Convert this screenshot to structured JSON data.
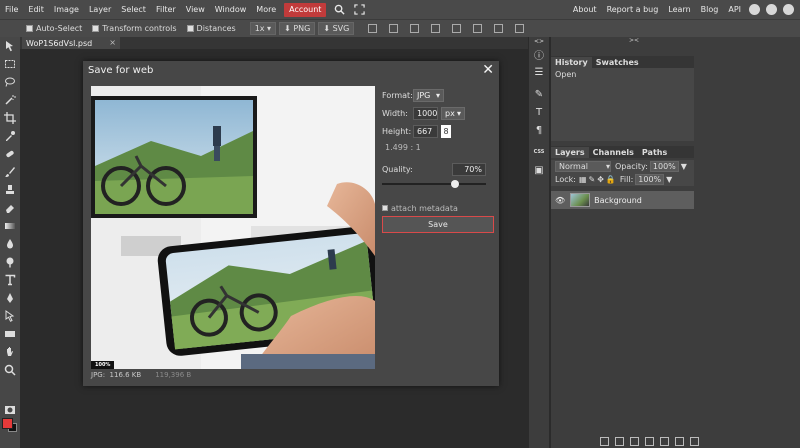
{
  "menubar": {
    "items": [
      "File",
      "Edit",
      "Image",
      "Layer",
      "Select",
      "Filter",
      "View",
      "Window",
      "More"
    ],
    "account": "Account",
    "right_links": [
      "About",
      "Report a bug",
      "Learn",
      "Blog",
      "API"
    ]
  },
  "options_bar": {
    "auto_select": "Auto-Select",
    "transform_controls": "Transform controls",
    "distances": "Distances",
    "zoom": "1x",
    "export_png": "PNG",
    "export_svg": "SVG"
  },
  "document_tab": {
    "name": "WoP1S6dVsl.psd",
    "close": "×"
  },
  "dialog": {
    "title": "Save for web",
    "close": "✕",
    "zoom_badge": "100%",
    "file_type": "JPG:",
    "file_size": "116.6 KB",
    "original_size": "119,396 B",
    "format_label": "Format:",
    "format_value": "JPG",
    "width_label": "Width:",
    "width_value": "1000",
    "width_unit": "px",
    "height_label": "Height:",
    "height_value": "667",
    "ratio": "1.499 : 1",
    "quality_label": "Quality:",
    "quality_value": "70%",
    "quality_level": 0.7,
    "metadata_label": "attach metadata",
    "save_label": "Save"
  },
  "history_panel": {
    "tabs": [
      "History",
      "Swatches"
    ],
    "items": [
      "Open"
    ]
  },
  "layers_panel": {
    "tabs": [
      "Layers",
      "Channels",
      "Paths"
    ],
    "blend_mode": "Normal",
    "opacity_label": "Opacity:",
    "opacity_value": "100%",
    "lock_label": "Lock:",
    "fill_label": "Fill:",
    "fill_value": "100%",
    "layer_name": "Background"
  },
  "right_strip": {
    "css_label": "CSS"
  },
  "colors": {
    "accent": "#c13b3b",
    "foreground": "#e53a3a",
    "background": "#111111"
  }
}
